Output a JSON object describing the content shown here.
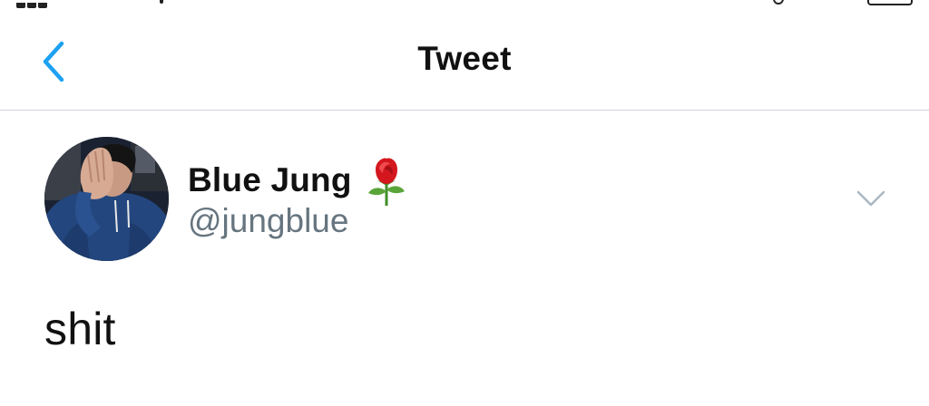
{
  "nav": {
    "title": "Tweet",
    "back_icon": "chevron-left-icon",
    "accent_color": "#1da1f2"
  },
  "tweet": {
    "author": {
      "name": "Blue Jung",
      "name_emoji": "rose-icon",
      "handle": "@jungblue",
      "avatar": "avatar-photo"
    },
    "more_icon": "chevron-down-icon",
    "text": "shit"
  },
  "colors": {
    "text_primary": "#111111",
    "text_secondary": "#66757f",
    "divider": "#cfd4d9",
    "background": "#ffffff"
  }
}
